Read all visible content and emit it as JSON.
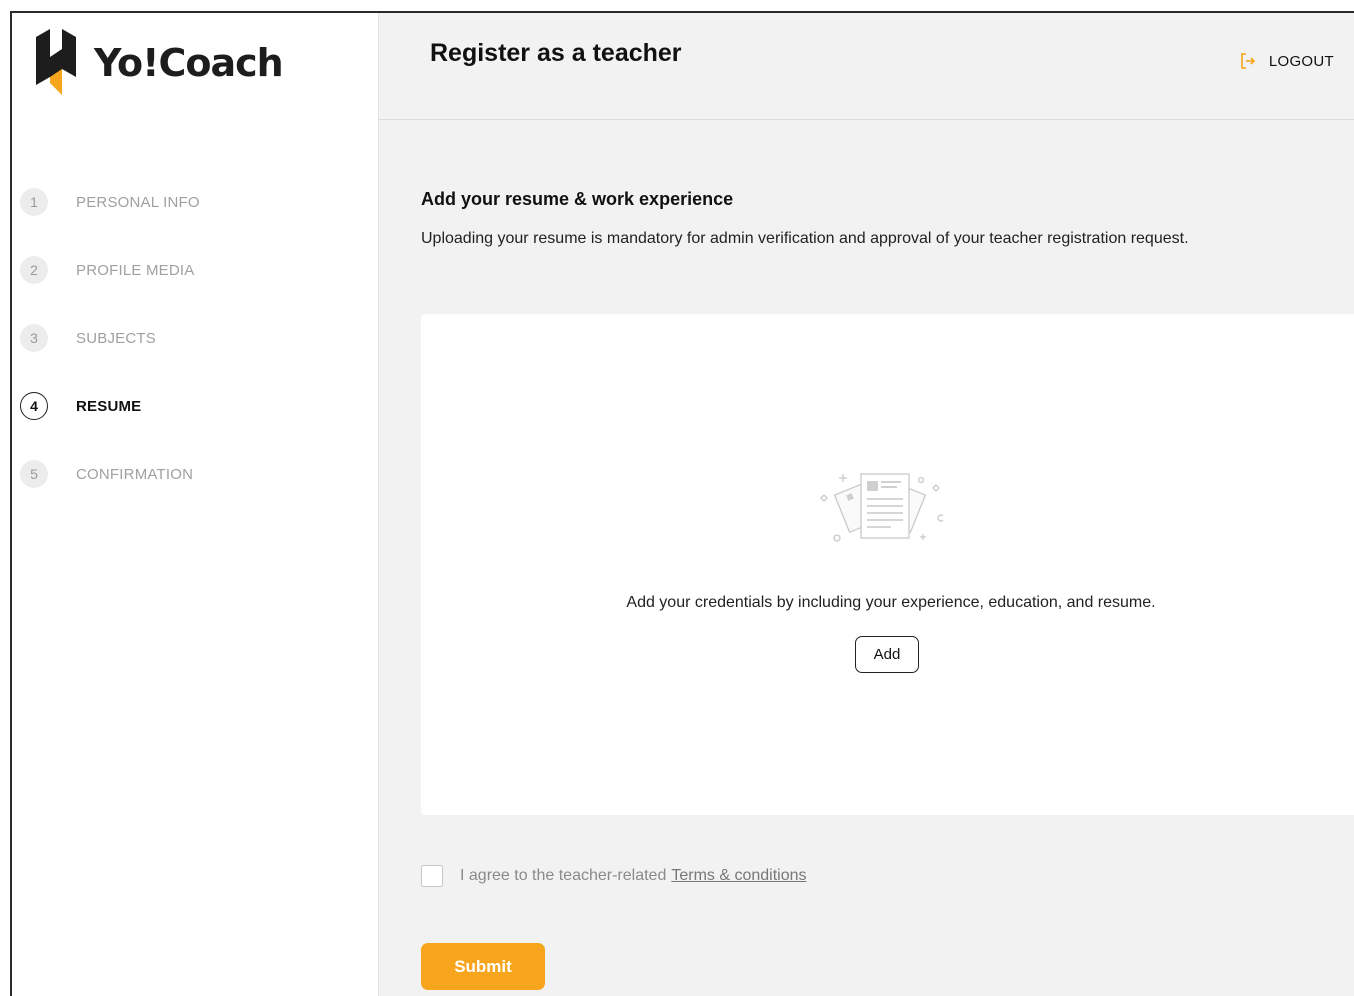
{
  "brand": {
    "name": "Yo!Coach",
    "accent": "#f7a51c",
    "dark": "#1d1d1d"
  },
  "sidebar": {
    "steps": [
      {
        "number": "1",
        "label": "PERSONAL INFO",
        "active": false
      },
      {
        "number": "2",
        "label": "PROFILE MEDIA",
        "active": false
      },
      {
        "number": "3",
        "label": "SUBJECTS",
        "active": false
      },
      {
        "number": "4",
        "label": "RESUME",
        "active": true
      },
      {
        "number": "5",
        "label": "CONFIRMATION",
        "active": false
      }
    ]
  },
  "header": {
    "title": "Register as a teacher",
    "logout_label": "LOGOUT",
    "logout_icon": "logout-icon"
  },
  "main": {
    "section_title": "Add your resume & work experience",
    "section_description": "Uploading your resume is mandatory for admin verification and approval of your teacher registration request.",
    "empty_state": {
      "icon": "document-icon",
      "text": "Add your credentials by including your experience, education, and resume.",
      "add_label": "Add"
    },
    "agreement": {
      "text": "I agree to the teacher-related",
      "link_text": "Terms & conditions",
      "checked": false
    },
    "submit_label": "Submit"
  }
}
